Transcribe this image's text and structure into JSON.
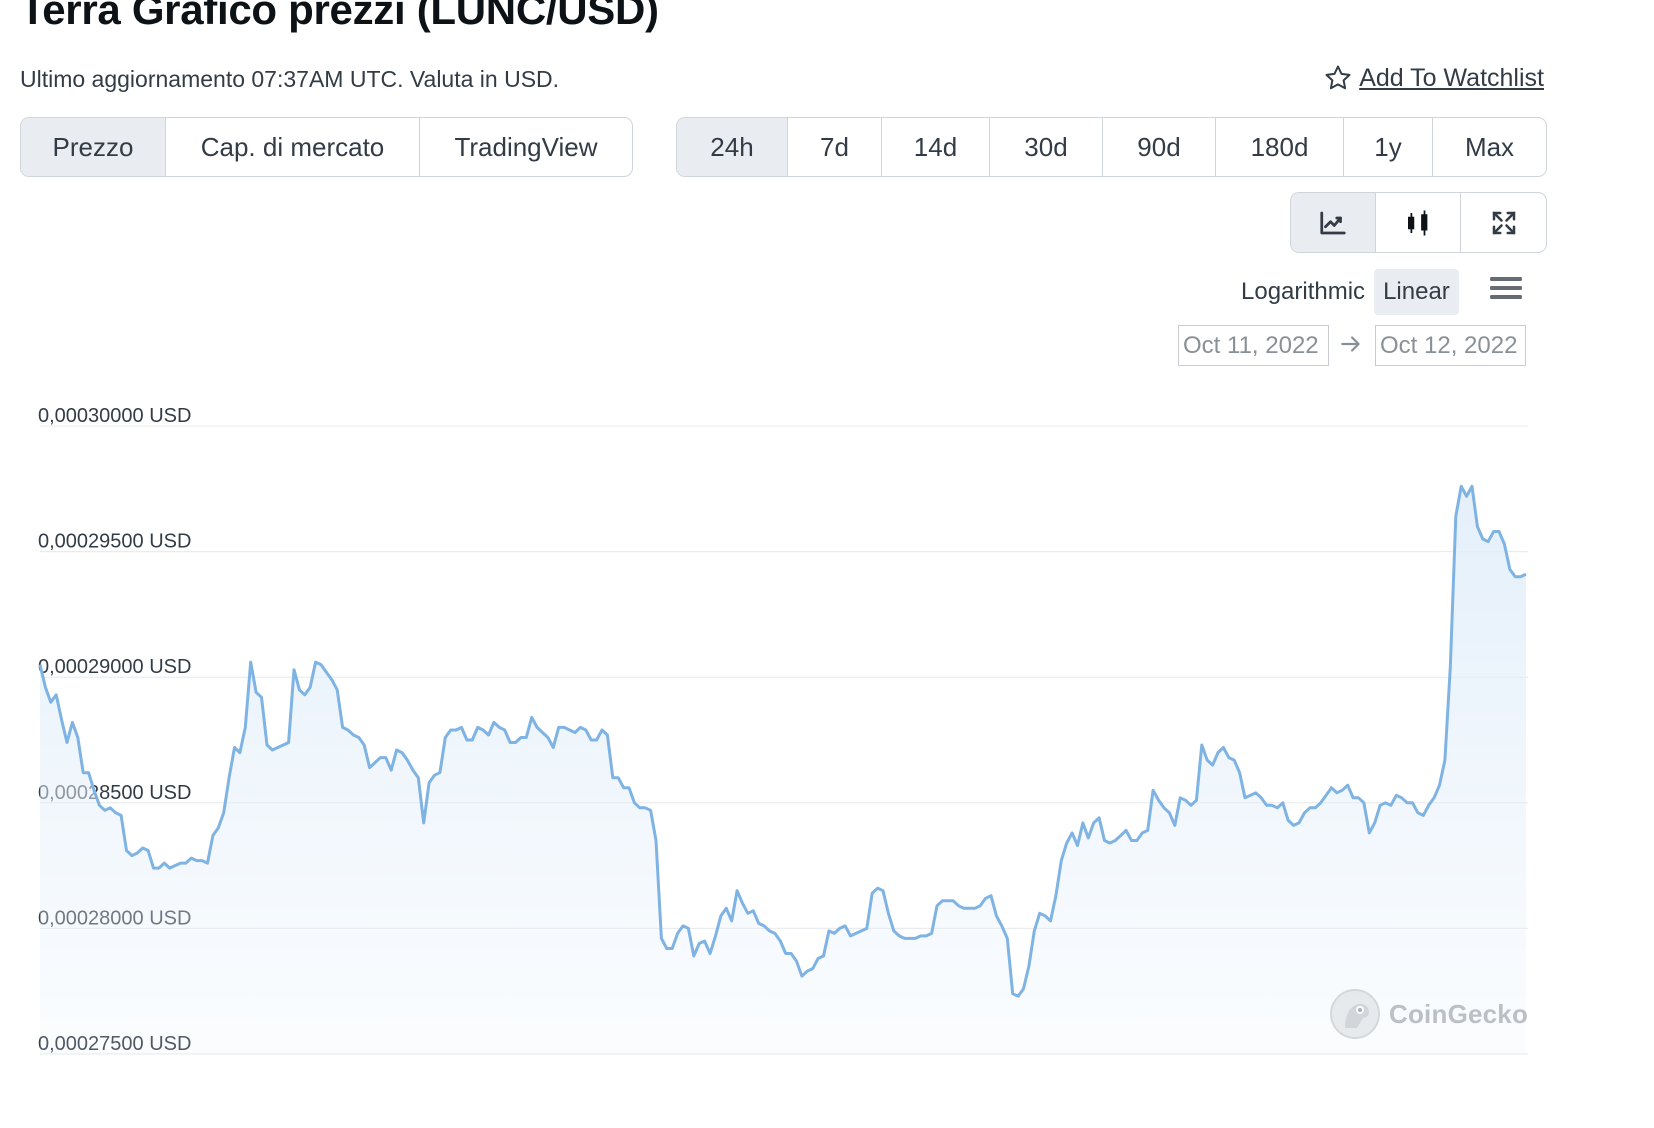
{
  "header": {
    "title": "Terra Grafico prezzi (LUNC/USD)",
    "subtitle": "Ultimo aggiornamento 07:37AM UTC. Valuta in USD.",
    "watchlist_label": " Add To Watchlist"
  },
  "tabs": [
    {
      "label": "Prezzo",
      "active": true
    },
    {
      "label": "Cap. di mercato",
      "active": false
    },
    {
      "label": "TradingView",
      "active": false
    }
  ],
  "ranges": [
    {
      "label": "24h",
      "active": true
    },
    {
      "label": "7d",
      "active": false
    },
    {
      "label": "14d",
      "active": false
    },
    {
      "label": "30d",
      "active": false
    },
    {
      "label": "90d",
      "active": false
    },
    {
      "label": "180d",
      "active": false
    },
    {
      "label": "1y",
      "active": false
    },
    {
      "label": "Max",
      "active": false
    }
  ],
  "chart_type_buttons": [
    {
      "icon": "line-chart-icon",
      "active": true
    },
    {
      "icon": "candlestick-icon",
      "active": false
    },
    {
      "icon": "fullscreen-icon",
      "active": false
    }
  ],
  "scale": {
    "logarithmic_label": "Logarithmic",
    "linear_label": "Linear",
    "active": "Linear"
  },
  "date_range": {
    "from": "Oct 11, 2022",
    "to": "Oct 12, 2022"
  },
  "watermark": {
    "text": "CoinGecko"
  },
  "colors": {
    "line": "#7eb3e3",
    "fill_top": "#e3effa",
    "grid": "#e6e8eb",
    "active_bg": "#e9ecf0"
  },
  "chart_data": {
    "type": "area",
    "title": "",
    "xlabel": "",
    "ylabel": "",
    "unit": "USD",
    "scale": "linear",
    "grid": true,
    "legend": "none",
    "ylim": [
      0.000275,
      0.0003
    ],
    "yticks": [
      "0,00030000 USD",
      "0,00029500 USD",
      "0,00029000 USD",
      "0,00028500 USD",
      "0,00028000 USD",
      "0,00027500 USD"
    ],
    "ytick_values": [
      0.0003,
      0.000295,
      0.00029,
      0.000285,
      0.00028,
      0.000275
    ],
    "series": [
      {
        "values": [
          0.0002905,
          0.0002896,
          0.000289,
          0.0002893,
          0.0002883,
          0.0002874,
          0.0002882,
          0.0002876,
          0.0002862,
          0.0002862,
          0.0002855,
          0.0002849,
          0.0002847,
          0.0002848,
          0.0002846,
          0.0002845,
          0.0002831,
          0.0002829,
          0.000283,
          0.0002832,
          0.0002831,
          0.0002824,
          0.0002824,
          0.0002826,
          0.0002824,
          0.0002825,
          0.0002826,
          0.0002826,
          0.0002828,
          0.0002827,
          0.0002827,
          0.0002826,
          0.0002837,
          0.000284,
          0.0002846,
          0.000286,
          0.0002872,
          0.000287,
          0.000288,
          0.0002906,
          0.0002894,
          0.0002892,
          0.0002873,
          0.0002871,
          0.0002872,
          0.0002873,
          0.0002874,
          0.0002903,
          0.0002895,
          0.0002893,
          0.0002896,
          0.0002906,
          0.0002905,
          0.0002902,
          0.0002899,
          0.0002895,
          0.000288,
          0.0002879,
          0.0002877,
          0.0002876,
          0.0002873,
          0.0002864,
          0.0002866,
          0.0002868,
          0.0002868,
          0.0002863,
          0.0002871,
          0.000287,
          0.0002867,
          0.0002863,
          0.000286,
          0.0002842,
          0.0002858,
          0.0002861,
          0.0002862,
          0.0002876,
          0.0002879,
          0.0002879,
          0.000288,
          0.0002875,
          0.0002875,
          0.000288,
          0.0002879,
          0.0002877,
          0.0002882,
          0.000288,
          0.0002879,
          0.0002874,
          0.0002874,
          0.0002876,
          0.0002876,
          0.0002884,
          0.000288,
          0.0002878,
          0.0002876,
          0.0002872,
          0.000288,
          0.000288,
          0.0002879,
          0.0002878,
          0.000288,
          0.0002879,
          0.0002875,
          0.0002875,
          0.0002879,
          0.0002877,
          0.000286,
          0.000286,
          0.0002856,
          0.0002856,
          0.000285,
          0.0002848,
          0.0002848,
          0.0002847,
          0.0002835,
          0.0002796,
          0.0002792,
          0.0002792,
          0.0002798,
          0.0002801,
          0.00028,
          0.0002789,
          0.0002794,
          0.0002795,
          0.000279,
          0.0002797,
          0.0002805,
          0.0002808,
          0.0002803,
          0.0002815,
          0.000281,
          0.0002806,
          0.0002807,
          0.0002802,
          0.0002801,
          0.0002799,
          0.0002798,
          0.0002795,
          0.000279,
          0.000279,
          0.0002787,
          0.0002781,
          0.0002783,
          0.0002784,
          0.0002788,
          0.0002789,
          0.0002799,
          0.0002798,
          0.00028,
          0.0002801,
          0.0002797,
          0.0002798,
          0.0002799,
          0.00028,
          0.0002814,
          0.0002816,
          0.0002815,
          0.0002806,
          0.0002799,
          0.0002797,
          0.0002796,
          0.0002796,
          0.0002796,
          0.0002797,
          0.0002797,
          0.0002798,
          0.0002809,
          0.0002811,
          0.0002811,
          0.0002811,
          0.0002809,
          0.0002808,
          0.0002808,
          0.0002808,
          0.0002809,
          0.0002812,
          0.0002813,
          0.0002805,
          0.0002801,
          0.0002796,
          0.0002774,
          0.0002773,
          0.0002776,
          0.0002785,
          0.0002799,
          0.0002806,
          0.0002805,
          0.0002803,
          0.0002813,
          0.0002827,
          0.0002834,
          0.0002838,
          0.0002833,
          0.0002842,
          0.0002836,
          0.0002842,
          0.0002844,
          0.0002835,
          0.0002834,
          0.0002835,
          0.0002837,
          0.0002839,
          0.0002835,
          0.0002835,
          0.0002838,
          0.0002839,
          0.0002855,
          0.0002851,
          0.0002848,
          0.0002846,
          0.0002841,
          0.0002852,
          0.0002851,
          0.0002849,
          0.0002851,
          0.0002873,
          0.0002867,
          0.0002865,
          0.000287,
          0.0002872,
          0.0002868,
          0.0002867,
          0.0002862,
          0.0002852,
          0.0002853,
          0.0002854,
          0.0002852,
          0.0002849,
          0.0002849,
          0.0002848,
          0.000285,
          0.0002843,
          0.0002841,
          0.0002842,
          0.0002846,
          0.0002848,
          0.0002848,
          0.000285,
          0.0002853,
          0.0002856,
          0.0002854,
          0.0002855,
          0.0002857,
          0.0002852,
          0.0002852,
          0.000285,
          0.0002838,
          0.0002842,
          0.0002849,
          0.000285,
          0.0002849,
          0.0002853,
          0.0002852,
          0.000285,
          0.000285,
          0.0002846,
          0.0002845,
          0.0002849,
          0.0002852,
          0.0002857,
          0.0002867,
          0.0002904,
          0.0002964,
          0.0002976,
          0.0002972,
          0.0002976,
          0.000296,
          0.0002955,
          0.0002954,
          0.0002958,
          0.0002958,
          0.0002953,
          0.0002943,
          0.000294,
          0.000294,
          0.0002941
        ]
      }
    ]
  }
}
